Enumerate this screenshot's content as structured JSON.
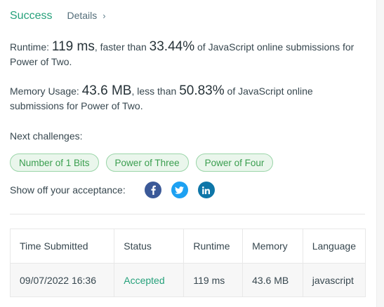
{
  "header": {
    "status": "Success",
    "details_label": "Details",
    "details_chevron": "›"
  },
  "runtime": {
    "label": "Runtime:",
    "value": "119 ms",
    "comparison_text": ", faster than",
    "percent": "33.44%",
    "suffix": "of JavaScript online submissions for Power of Two."
  },
  "memory": {
    "label": "Memory Usage:",
    "value": "43.6 MB",
    "comparison_text": ", less than",
    "percent": "50.83%",
    "suffix": "of JavaScript online submissions for Power of Two."
  },
  "next_challenges": {
    "label": "Next challenges:",
    "items": [
      "Number of 1 Bits",
      "Power of Three",
      "Power of Four"
    ]
  },
  "share": {
    "label": "Show off your acceptance:",
    "icons": [
      "facebook-icon",
      "twitter-icon",
      "linkedin-icon"
    ]
  },
  "table": {
    "headers": [
      "Time Submitted",
      "Status",
      "Runtime",
      "Memory",
      "Language"
    ],
    "rows": [
      [
        "09/07/2022 16:36",
        "Accepted",
        "119 ms",
        "43.6 MB",
        "javascript"
      ]
    ]
  },
  "colors": {
    "success": "#26a17b",
    "chip_border": "#9ad5a8",
    "chip_bg": "#eaf6ec",
    "facebook": "#3b5998",
    "twitter": "#1da1f2",
    "linkedin": "#0e76a8"
  }
}
